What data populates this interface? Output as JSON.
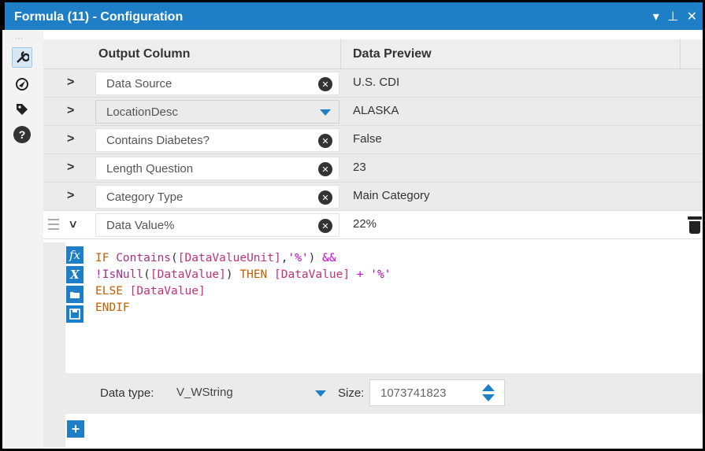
{
  "window": {
    "title": "Formula (11) - Configuration",
    "controls": [
      "▾",
      "⊥",
      "✕"
    ]
  },
  "columns": {
    "output_column": "Output Column",
    "data_preview": "Data Preview"
  },
  "rows": [
    {
      "name": "Data Source",
      "preview": "U.S. CDI",
      "control": "clear"
    },
    {
      "name": "LocationDesc",
      "preview": "ALASKA",
      "control": "dropdown"
    },
    {
      "name": "Contains Diabetes?",
      "preview": "False",
      "control": "clear"
    },
    {
      "name": "Length Question",
      "preview": "23",
      "control": "clear"
    },
    {
      "name": "Category Type",
      "preview": "Main Category",
      "control": "clear"
    },
    {
      "name": "Data Value%",
      "preview": "22%",
      "control": "clear",
      "expanded": true
    }
  ],
  "expression": {
    "line1": {
      "a": "IF ",
      "b": "Contains",
      "c": "(",
      "d": "[DataValueUnit]",
      "e": ",",
      "f": "'%'",
      "g": ") ",
      "h": "&&"
    },
    "line2": {
      "a": "!",
      "b": "IsNull",
      "c": "(",
      "d": "[DataValue]",
      "e": ") ",
      "f": "THEN ",
      "g": "[DataValue]",
      "h": " + ",
      "i": "'%'"
    },
    "line3": {
      "a": "ELSE ",
      "b": "[DataValue]"
    },
    "line4": {
      "a": "ENDIF"
    }
  },
  "formula_icons": [
    "fx",
    "X",
    "open",
    "save"
  ],
  "data_type": {
    "label": "Data type:",
    "value": "V_WString",
    "size_label": "Size:",
    "size_value": "1073741823"
  },
  "add_button": "+",
  "colors": {
    "accent": "#1e7fc6",
    "keyword": "#c06000",
    "function": "#a0328c",
    "field": "#c0307a",
    "string": "#b000b0"
  }
}
